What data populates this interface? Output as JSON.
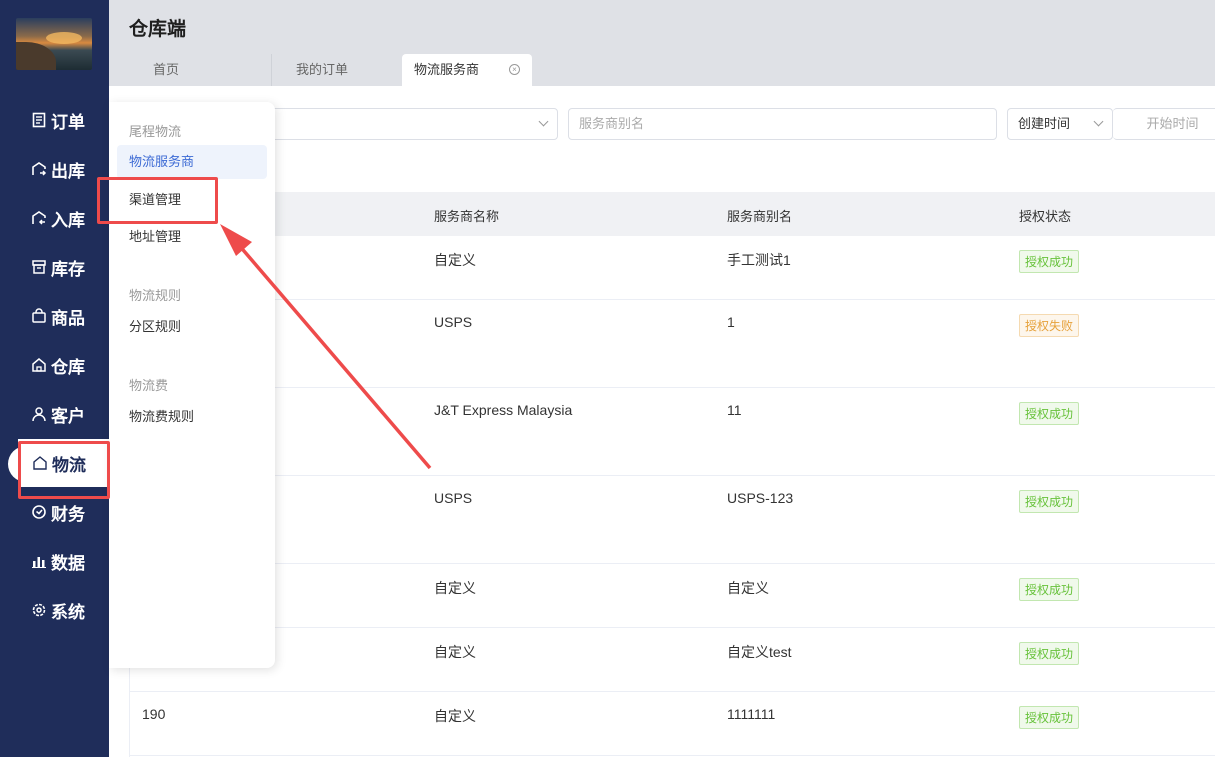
{
  "app": {
    "title": "仓库端"
  },
  "tabs": [
    {
      "label": "首页"
    },
    {
      "label": "我的订单"
    },
    {
      "label": "物流服务商",
      "close": "×"
    }
  ],
  "nav": [
    {
      "label": "订单",
      "icon": "order-icon"
    },
    {
      "label": "出库",
      "icon": "outbound-icon"
    },
    {
      "label": "入库",
      "icon": "inbound-icon"
    },
    {
      "label": "库存",
      "icon": "inventory-icon"
    },
    {
      "label": "商品",
      "icon": "product-icon"
    },
    {
      "label": "仓库",
      "icon": "warehouse-icon"
    },
    {
      "label": "客户",
      "icon": "customer-icon"
    },
    {
      "label": "物流",
      "icon": "logistics-icon",
      "active": true
    },
    {
      "label": "财务",
      "icon": "finance-icon"
    },
    {
      "label": "数据",
      "icon": "data-icon"
    },
    {
      "label": "系统",
      "icon": "settings-icon"
    }
  ],
  "flyout": {
    "groups": [
      {
        "title": "尾程物流",
        "items": [
          "物流服务商",
          "渠道管理",
          "地址管理"
        ]
      },
      {
        "title": "物流规则",
        "items": [
          "分区规则"
        ]
      },
      {
        "title": "物流费",
        "items": [
          "物流费规则"
        ]
      }
    ]
  },
  "filters": {
    "alias_placeholder": "服务商别名",
    "time_type": "创建时间",
    "start_placeholder": "开始时间"
  },
  "table": {
    "headers": [
      "服务商名称",
      "服务商别名",
      "授权状态"
    ],
    "rows": [
      {
        "id": "",
        "name": "自定义",
        "alias": "手工测试1",
        "status": "授权成功",
        "ok": true
      },
      {
        "id": "",
        "name": "USPS",
        "alias": "1",
        "status": "授权失败",
        "ok": false
      },
      {
        "id": "",
        "name": "J&T Express Malaysia",
        "alias": "11",
        "status": "授权成功",
        "ok": true
      },
      {
        "id": "",
        "name": "USPS",
        "alias": "USPS-123",
        "status": "授权成功",
        "ok": true
      },
      {
        "id": "",
        "name": "自定义",
        "alias": "自定义",
        "status": "授权成功",
        "ok": true
      },
      {
        "id": "",
        "name": "自定义",
        "alias": "自定义test",
        "status": "授权成功",
        "ok": true
      },
      {
        "id": "190",
        "name": "自定义",
        "alias": "1111111",
        "status": "授权成功",
        "ok": true
      }
    ]
  },
  "colors": {
    "sidebar": "#1f2d5a",
    "accent": "#3c6ad4",
    "annotation": "#ee4b4b",
    "success": "#67c23a",
    "warning": "#e6a23c"
  }
}
